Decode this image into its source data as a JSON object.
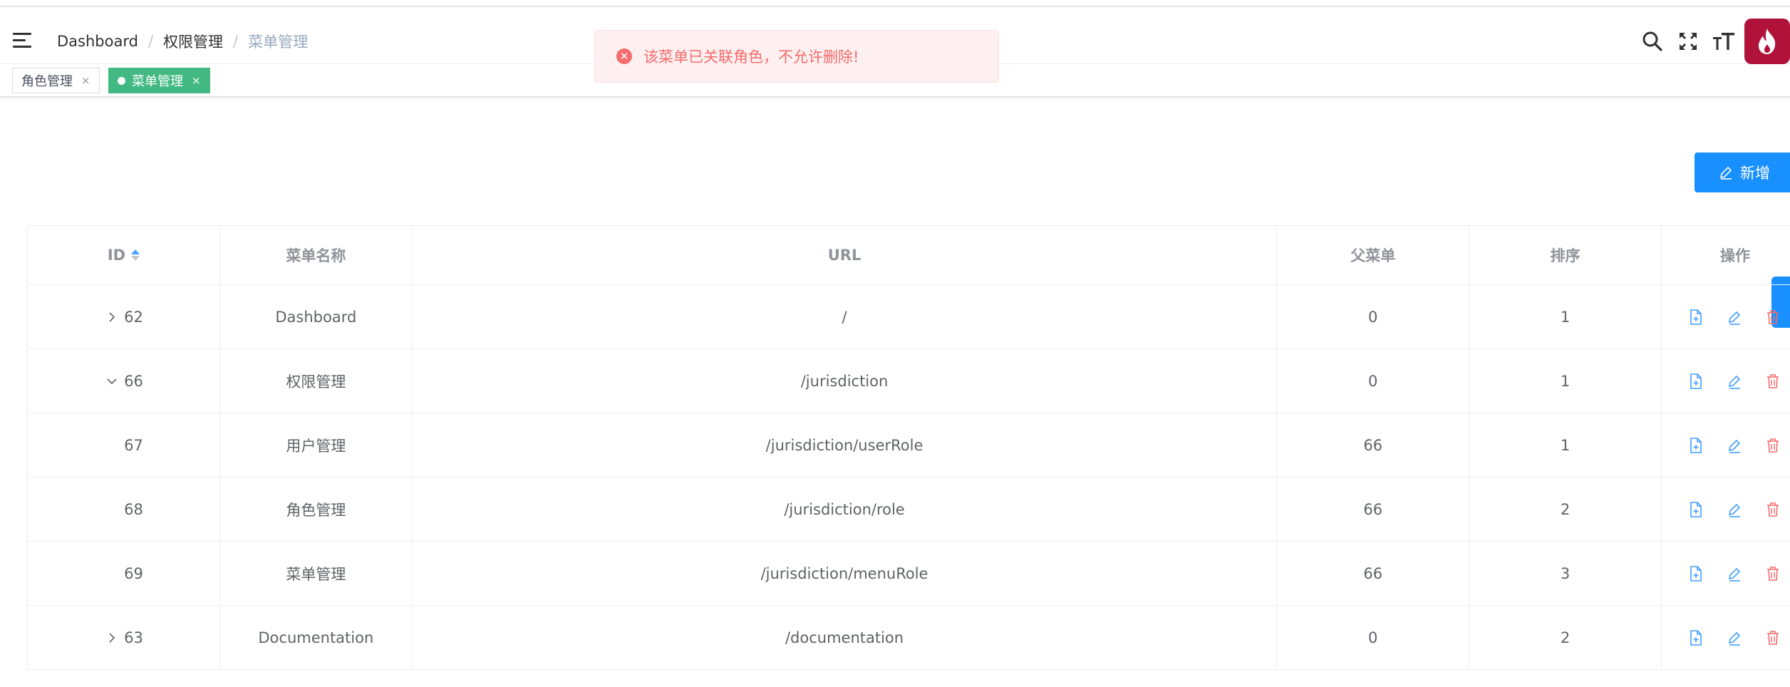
{
  "breadcrumb": [
    "Dashboard",
    "权限管理",
    "菜单管理"
  ],
  "navbar_icons": [
    "search-icon",
    "fullscreen-icon",
    "text-size-icon"
  ],
  "tags": [
    {
      "label": "角色管理",
      "active": false
    },
    {
      "label": "菜单管理",
      "active": true
    }
  ],
  "toast": {
    "text": "该菜单已关联角色，不允许删除!",
    "type": "error"
  },
  "add_button": {
    "label": "新增"
  },
  "table": {
    "headers": {
      "id": "ID",
      "name": "菜单名称",
      "url": "URL",
      "parent": "父菜单",
      "sort": "排序",
      "ops": "操作"
    },
    "rows": [
      {
        "id": "62",
        "name": "Dashboard",
        "url": "/",
        "parent": "0",
        "sort": "1",
        "expand": "collapsed"
      },
      {
        "id": "66",
        "name": "权限管理",
        "url": "/jurisdiction",
        "parent": "0",
        "sort": "1",
        "expand": "expanded"
      },
      {
        "id": "67",
        "name": "用户管理",
        "url": "/jurisdiction/userRole",
        "parent": "66",
        "sort": "1",
        "expand": "none"
      },
      {
        "id": "68",
        "name": "角色管理",
        "url": "/jurisdiction/role",
        "parent": "66",
        "sort": "2",
        "expand": "none"
      },
      {
        "id": "69",
        "name": "菜单管理",
        "url": "/jurisdiction/menuRole",
        "parent": "66",
        "sort": "3",
        "expand": "none"
      },
      {
        "id": "63",
        "name": "Documentation",
        "url": "/documentation",
        "parent": "0",
        "sort": "2",
        "expand": "collapsed"
      }
    ]
  },
  "colors": {
    "primary": "#1890ff",
    "tag_active": "#42b983",
    "danger": "#f56c6c",
    "avatar": "#b0123a"
  }
}
